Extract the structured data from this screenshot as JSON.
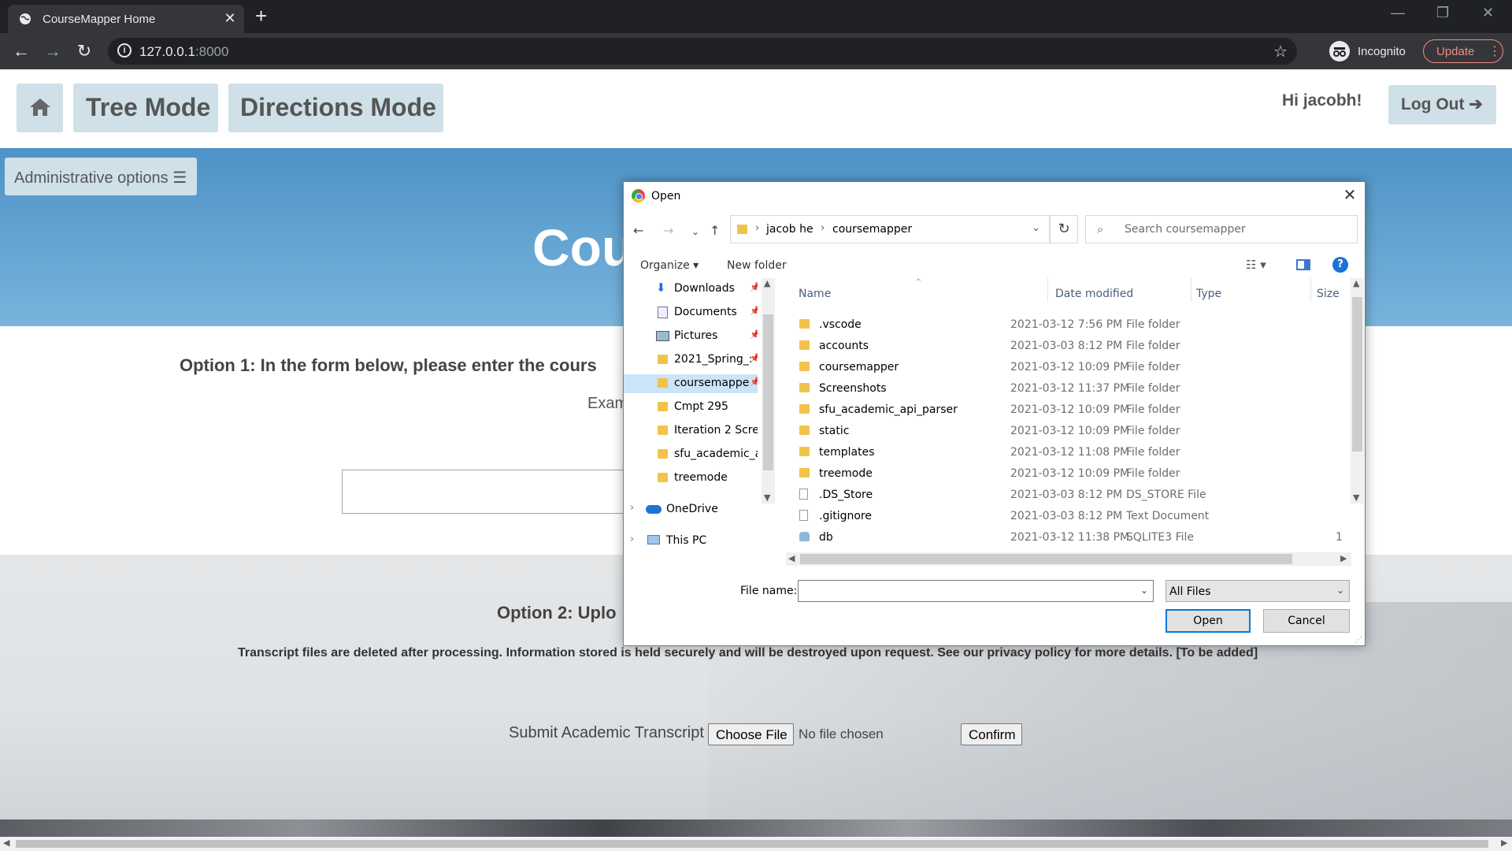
{
  "browser": {
    "tab_title": "CourseMapper Home",
    "tab_close": "✕",
    "new_tab": "+",
    "url_host": "127.0.0.1",
    "url_port": ":8000",
    "incognito_label": "Incognito",
    "update_label": "Update",
    "win_min": "—",
    "win_max": "❐",
    "win_close": "✕"
  },
  "site": {
    "nav": {
      "home_icon": "home-icon",
      "tree_mode": "Tree Mode",
      "directions_mode": "Directions Mode"
    },
    "greeting": "Hi jacobh!",
    "logout": "Log Out ➔",
    "admin_options": "Administrative options ☰",
    "hero_title": "Cou",
    "option1": "Option 1: In the form below, please enter the cours",
    "example_text": "Exam",
    "option2": "Option 2: Uplo",
    "privacy_notice": "Transcript files are deleted after processing. Information stored is held securely and will be destroyed upon request. See our privacy policy for more details. [To be added]",
    "submit_label": "Submit Academic Transcript",
    "choose_file": "Choose File",
    "no_file": "No file chosen",
    "confirm": "Confirm"
  },
  "dialog": {
    "title": "Open",
    "close": "✕",
    "path": [
      "jacob he",
      "coursemapper"
    ],
    "search_placeholder": "Search coursemapper",
    "organize": "Organize ▾",
    "new_folder": "New folder",
    "help": "?",
    "nav_items": [
      {
        "label": "Downloads",
        "pinned": true
      },
      {
        "label": "Documents",
        "pinned": true
      },
      {
        "label": "Pictures",
        "pinned": true
      },
      {
        "label": "2021_Spring_:",
        "pinned": true
      },
      {
        "label": "coursemappe",
        "pinned": true,
        "selected": true
      },
      {
        "label": "Cmpt 295",
        "pinned": false
      },
      {
        "label": "Iteration 2 Scree",
        "pinned": false
      },
      {
        "label": "sfu_academic_ap",
        "pinned": false
      },
      {
        "label": "treemode",
        "pinned": false
      },
      {
        "label": "OneDrive",
        "pinned": false
      },
      {
        "label": "This PC",
        "pinned": false
      }
    ],
    "columns": {
      "name": "Name",
      "date": "Date modified",
      "type": "Type",
      "size": "Size"
    },
    "files": [
      {
        "name": ".vscode",
        "date": "2021-03-12 7:56 PM",
        "type": "File folder",
        "size": "",
        "icon": "folder-icon"
      },
      {
        "name": "accounts",
        "date": "2021-03-03 8:12 PM",
        "type": "File folder",
        "size": "",
        "icon": "folder-icon"
      },
      {
        "name": "coursemapper",
        "date": "2021-03-12 10:09 PM",
        "type": "File folder",
        "size": "",
        "icon": "folder-icon"
      },
      {
        "name": "Screenshots",
        "date": "2021-03-12 11:37 PM",
        "type": "File folder",
        "size": "",
        "icon": "folder-icon"
      },
      {
        "name": "sfu_academic_api_parser",
        "date": "2021-03-12 10:09 PM",
        "type": "File folder",
        "size": "",
        "icon": "folder-icon"
      },
      {
        "name": "static",
        "date": "2021-03-12 10:09 PM",
        "type": "File folder",
        "size": "",
        "icon": "folder-icon"
      },
      {
        "name": "templates",
        "date": "2021-03-12 11:08 PM",
        "type": "File folder",
        "size": "",
        "icon": "folder-icon"
      },
      {
        "name": "treemode",
        "date": "2021-03-12 10:09 PM",
        "type": "File folder",
        "size": "",
        "icon": "folder-icon"
      },
      {
        "name": ".DS_Store",
        "date": "2021-03-03 8:12 PM",
        "type": "DS_STORE File",
        "size": "",
        "icon": "file-icon"
      },
      {
        "name": ".gitignore",
        "date": "2021-03-03 8:12 PM",
        "type": "Text Document",
        "size": "",
        "icon": "text-file-icon"
      },
      {
        "name": "db",
        "date": "2021-03-12 11:38 PM",
        "type": "SQLITE3 File",
        "size": "1",
        "icon": "database-file-icon"
      }
    ],
    "file_name_label": "File name:",
    "file_name_value": "",
    "file_type": "All Files",
    "open": "Open",
    "cancel": "Cancel"
  }
}
